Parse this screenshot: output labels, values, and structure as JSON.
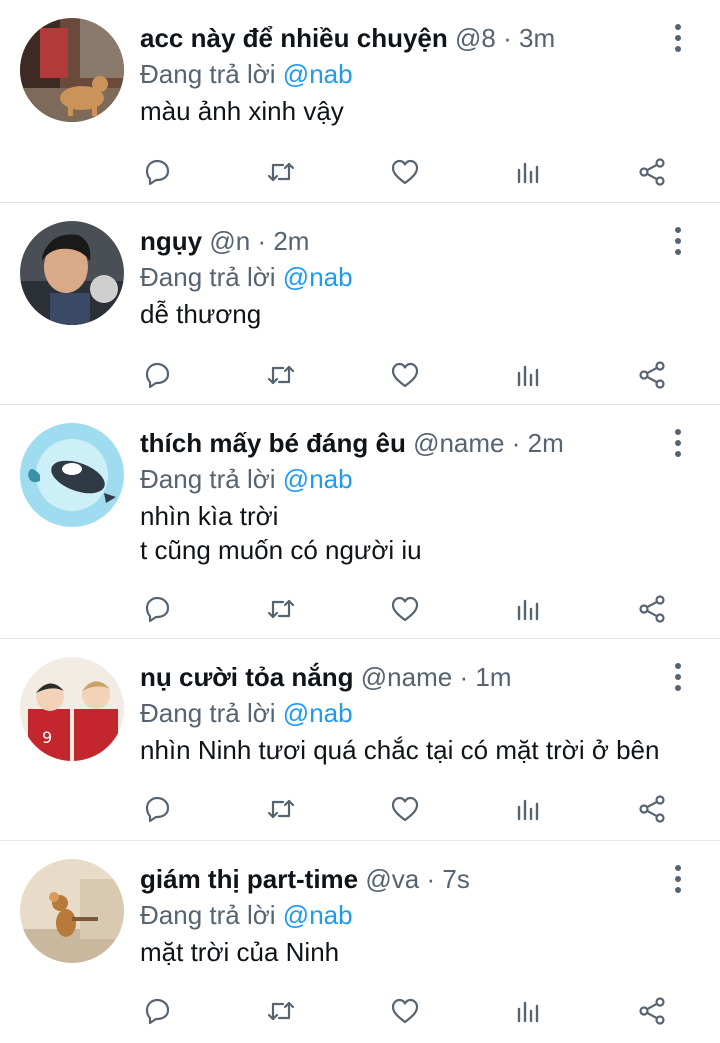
{
  "colors": {
    "accent": "#1d9bf0",
    "secondary": "#566370",
    "divider": "#e1e6ea"
  },
  "tweets": [
    {
      "name": "acc này để nhiều chuyện",
      "handle": "@8",
      "time": "3m",
      "reply_prefix": "Đang trả lời",
      "reply_to": "@nab",
      "text": "màu ảnh xinh vậy",
      "avatar": "cat-photo"
    },
    {
      "name": "ngụy",
      "handle": "@n",
      "time": "2m",
      "reply_prefix": "Đang trả lời",
      "reply_to": "@nab",
      "text": "dễ thương",
      "avatar": "person-photo"
    },
    {
      "name": "thích mấy bé đáng êu",
      "handle": "@name",
      "time": "2m",
      "reply_prefix": "Đang trả lời",
      "reply_to": "@nab",
      "text": "nhìn kìa trời\nt cũng muốn có người iu",
      "avatar": "whale-illustration"
    },
    {
      "name": "nụ cười tỏa nắng",
      "handle": "@name",
      "time": "1m",
      "reply_prefix": "Đang trả lời",
      "reply_to": "@nab",
      "text": "nhìn Ninh tươi quá chắc tại có mặt trời ở bên",
      "avatar": "anime-volleyball"
    },
    {
      "name": "giám thị part-time",
      "handle": "@va",
      "time": "7s",
      "reply_prefix": "Đang trả lời",
      "reply_to": "@nab",
      "text": "mặt trời của Ninh",
      "avatar": "cartoon-mouse"
    }
  ],
  "action_icons": [
    "reply-icon",
    "retweet-icon",
    "like-icon",
    "analytics-icon",
    "share-icon"
  ],
  "separator": "·"
}
